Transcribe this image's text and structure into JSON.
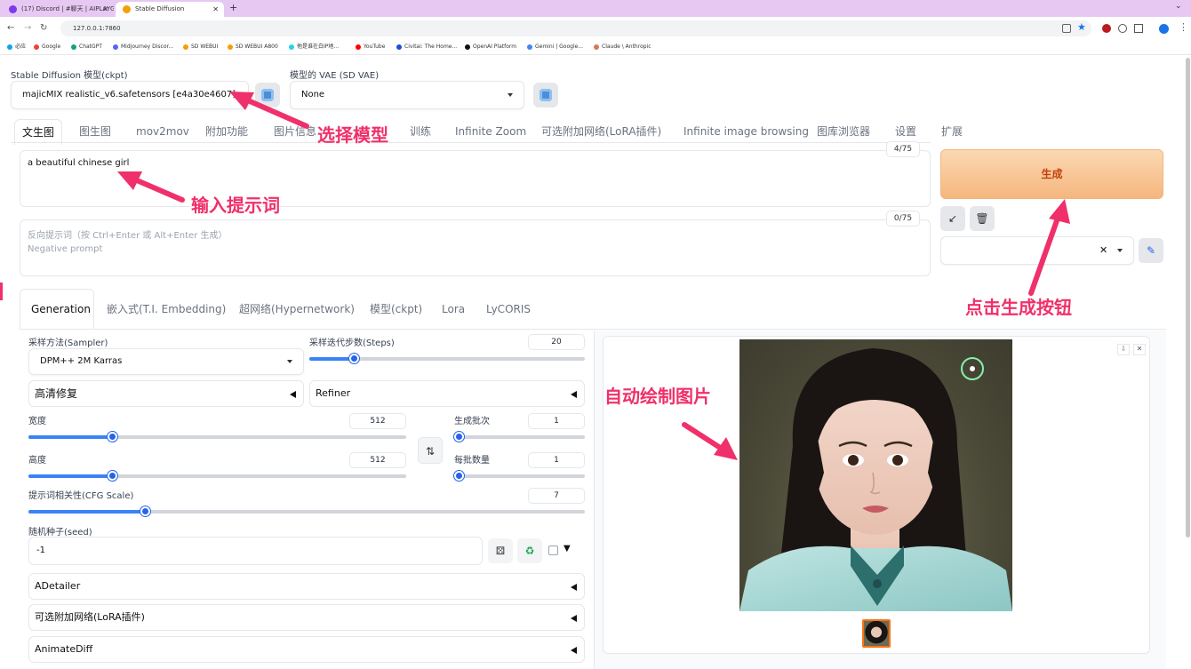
{
  "browser": {
    "tabs": [
      {
        "title": "(17) Discord | #聊天 | AIPLAYG...",
        "color": "#7c3aed"
      },
      {
        "title": "Stable Diffusion",
        "color": "#f59e0b"
      }
    ],
    "url": "127.0.0.1:7860",
    "bookmarks": [
      {
        "label": "必应",
        "color": "#0ea5e9"
      },
      {
        "label": "Google",
        "color": "#ea4335"
      },
      {
        "label": "ChatGPT",
        "color": "#10a37f"
      },
      {
        "label": "Midjourney Discor...",
        "color": "#5865f2"
      },
      {
        "label": "SD WEBUI",
        "color": "#f59e0b"
      },
      {
        "label": "SD WEBUI A800",
        "color": "#f59e0b"
      },
      {
        "label": "他是谁在白IP地...",
        "color": "#22d3ee"
      },
      {
        "label": "YouTube",
        "color": "#ff0000"
      },
      {
        "label": "Civitai: The Home...",
        "color": "#1d4ed8"
      },
      {
        "label": "OpenAI Platform",
        "color": "#111111"
      },
      {
        "label": "Gemini | Google...",
        "color": "#4285f4"
      },
      {
        "label": "Claude \\ Anthropic",
        "color": "#d97757"
      }
    ]
  },
  "model": {
    "ckpt_label": "Stable Diffusion 模型(ckpt)",
    "ckpt_value": "majicMIX realistic_v6.safetensors [e4a30e4607]",
    "vae_label": "模型的 VAE (SD VAE)",
    "vae_value": "None"
  },
  "main_tabs": [
    "文生图",
    "图生图",
    "mov2mov",
    "附加功能",
    "图片信息",
    "",
    "训练",
    "Infinite Zoom",
    "可选附加网络(LoRA插件)",
    "Infinite image browsing",
    "图库浏览器",
    "设置",
    "扩展"
  ],
  "prompt": {
    "value": "a beautiful chinese girl",
    "counter": "4/75",
    "neg_placeholder_1": "反向提示词（按 Ctrl+Enter 或 Alt+Enter 生成）",
    "neg_placeholder_2": "Negative prompt",
    "neg_counter": "0/75"
  },
  "generate_label": "生成",
  "sub_tabs": [
    "Generation",
    "嵌入式(T.I. Embedding)",
    "超网络(Hypernetwork)",
    "模型(ckpt)",
    "Lora",
    "LyCORIS"
  ],
  "params": {
    "sampler_label": "采样方法(Sampler)",
    "sampler_value": "DPM++ 2M Karras",
    "steps_label": "采样迭代步数(Steps)",
    "steps": "20",
    "hires_label": "高清修复",
    "refiner_label": "Refiner",
    "width_label": "宽度",
    "width": "512",
    "height_label": "高度",
    "height": "512",
    "batch_count_label": "生成批次",
    "batch_count": "1",
    "batch_size_label": "每批数量",
    "batch_size": "1",
    "cfg_label": "提示词相关性(CFG Scale)",
    "cfg": "7",
    "seed_label": "随机种子(seed)",
    "seed": "-1"
  },
  "sliders": {
    "steps": 0.16,
    "width": 0.22,
    "height": 0.22,
    "batch_count": 0.0,
    "batch_size": 0.0,
    "cfg": 0.21
  },
  "accordions": [
    "ADetailer",
    "可选附加网络(LoRA插件)",
    "AnimateDiff"
  ],
  "annotations": {
    "choose_model": "选择模型",
    "enter_prompt": "输入提示词",
    "click_generate": "点击生成按钮",
    "auto_draw": "自动绘制图片"
  },
  "colors": {
    "accent": "#f0306a",
    "slider": "#2563eb",
    "generate": "#f5b67e"
  }
}
